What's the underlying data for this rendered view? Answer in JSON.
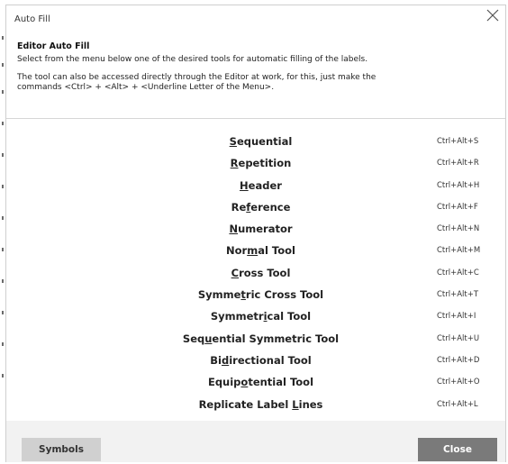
{
  "window": {
    "title": "Auto Fill",
    "close_icon": "close-icon"
  },
  "header": {
    "title": "Editor Auto Fill",
    "description": "Select from the menu below one of the desired tools for automatic filling of the labels.",
    "note": "The tool can also be accessed directly through the Editor at work, for this, just make the commands <Ctrl> + <Alt> + <Underline Letter of the Menu>."
  },
  "tools": [
    {
      "pre": "",
      "u": "S",
      "post": "equential",
      "shortcut": "Ctrl+Alt+S"
    },
    {
      "pre": "",
      "u": "R",
      "post": "epetition",
      "shortcut": "Ctrl+Alt+R"
    },
    {
      "pre": "",
      "u": "H",
      "post": "eader",
      "shortcut": "Ctrl+Alt+H"
    },
    {
      "pre": "Re",
      "u": "f",
      "post": "erence",
      "shortcut": "Ctrl+Alt+F"
    },
    {
      "pre": "",
      "u": "N",
      "post": "umerator",
      "shortcut": "Ctrl+Alt+N"
    },
    {
      "pre": "Nor",
      "u": "m",
      "post": "al Tool",
      "shortcut": "Ctrl+Alt+M"
    },
    {
      "pre": "",
      "u": "C",
      "post": "ross Tool",
      "shortcut": "Ctrl+Alt+C"
    },
    {
      "pre": "Symme",
      "u": "t",
      "post": "ric Cross Tool",
      "shortcut": "Ctrl+Alt+T"
    },
    {
      "pre": "Symmetr",
      "u": "i",
      "post": "cal Tool",
      "shortcut": "Ctrl+Alt+I"
    },
    {
      "pre": "Seq",
      "u": "u",
      "post": "ential Symmetric Tool",
      "shortcut": "Ctrl+Alt+U"
    },
    {
      "pre": "Bi",
      "u": "d",
      "post": "irectional Tool",
      "shortcut": "Ctrl+Alt+D"
    },
    {
      "pre": "Equip",
      "u": "o",
      "post": "tential Tool",
      "shortcut": "Ctrl+Alt+O"
    },
    {
      "pre": "Replicate Label ",
      "u": "L",
      "post": "ines",
      "shortcut": "Ctrl+Alt+L"
    }
  ],
  "footer": {
    "symbols_label": "Symbols",
    "close_label": "Close"
  }
}
